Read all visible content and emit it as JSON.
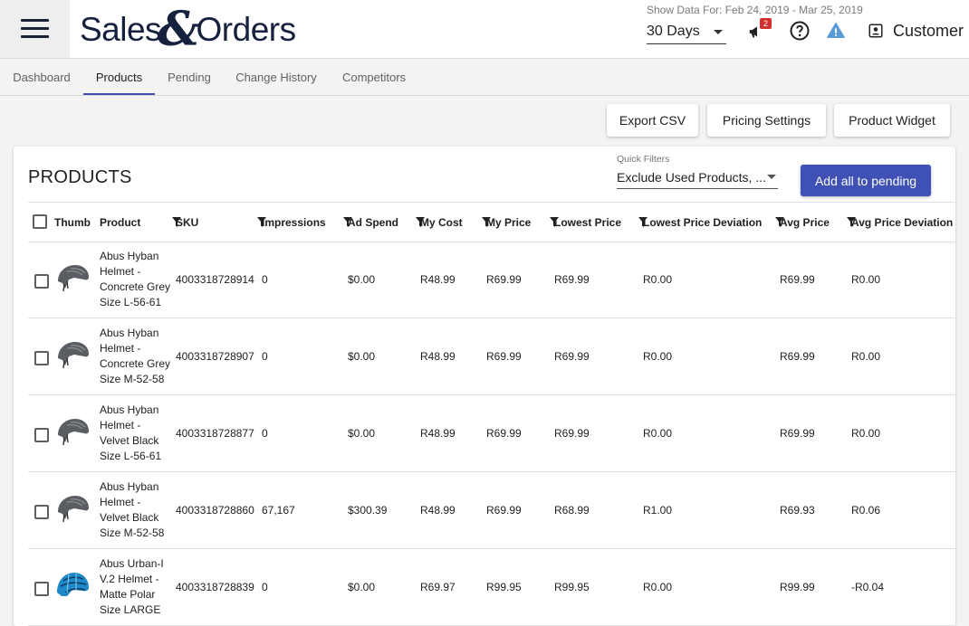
{
  "header": {
    "logo_left": "Sales",
    "logo_amp": "&",
    "logo_right": "Orders",
    "show_data_label": "Show Data For: Feb 24, 2019 - Mar 25, 2019",
    "days_value": "30 Days",
    "notification_count": "2",
    "customer_label": "Customer",
    "icons": [
      "menu-icon",
      "megaphone-icon",
      "help-icon",
      "alert-triangle-icon",
      "account-box-icon"
    ]
  },
  "tabs": [
    {
      "label": "Dashboard",
      "active": false
    },
    {
      "label": "Products",
      "active": true
    },
    {
      "label": "Pending",
      "active": false
    },
    {
      "label": "Change History",
      "active": false
    },
    {
      "label": "Competitors",
      "active": false
    }
  ],
  "actions": {
    "export_csv": "Export CSV",
    "pricing_settings": "Pricing Settings",
    "product_widget": "Product Widget"
  },
  "card": {
    "title": "PRODUCTS",
    "quick_filters_label": "Quick Filters",
    "quick_filters_value": "Exclude Used Products, ...",
    "add_all_label": "Add all to pending"
  },
  "table": {
    "columns": [
      "Thumb",
      "Product",
      "SKU",
      "Impressions",
      "Ad Spend",
      "My Cost",
      "My Price",
      "Lowest Price",
      "Lowest Price Deviation",
      "Avg Price",
      "Avg Price Deviation"
    ],
    "rows": [
      {
        "product": "Abus Hyban Helmet - Concrete Grey Size L-56-61",
        "thumb": "grey",
        "sku": "4003318728914",
        "impressions": "0",
        "ad_spend": "$0.00",
        "my_cost": "R48.99",
        "my_price": "R69.99",
        "lowest_price": "R69.99",
        "lowest_dev": "R0.00",
        "avg_price": "R69.99",
        "avg_dev": "R0.00"
      },
      {
        "product": "Abus Hyban Helmet - Concrete Grey Size M-52-58",
        "thumb": "grey",
        "sku": "4003318728907",
        "impressions": "0",
        "ad_spend": "$0.00",
        "my_cost": "R48.99",
        "my_price": "R69.99",
        "lowest_price": "R69.99",
        "lowest_dev": "R0.00",
        "avg_price": "R69.99",
        "avg_dev": "R0.00"
      },
      {
        "product": "Abus Hyban Helmet - Velvet Black Size L-56-61",
        "thumb": "grey",
        "sku": "4003318728877",
        "impressions": "0",
        "ad_spend": "$0.00",
        "my_cost": "R48.99",
        "my_price": "R69.99",
        "lowest_price": "R69.99",
        "lowest_dev": "R0.00",
        "avg_price": "R69.99",
        "avg_dev": "R0.00"
      },
      {
        "product": "Abus Hyban Helmet - Velvet Black Size M-52-58",
        "thumb": "grey",
        "sku": "4003318728860",
        "impressions": "67,167",
        "ad_spend": "$300.39",
        "my_cost": "R48.99",
        "my_price": "R69.99",
        "lowest_price": "R68.99",
        "lowest_dev": "R1.00",
        "avg_price": "R69.93",
        "avg_dev": "R0.06"
      },
      {
        "product": "Abus Urban-I V.2 Helmet - Matte Polar Size LARGE",
        "thumb": "blue",
        "sku": "4003318728839",
        "impressions": "0",
        "ad_spend": "$0.00",
        "my_cost": "R69.97",
        "my_price": "R99.95",
        "lowest_price": "R99.95",
        "lowest_dev": "R0.00",
        "avg_price": "R99.99",
        "avg_dev": "-R0.04"
      }
    ]
  },
  "colors": {
    "primary": "#3f51b5",
    "badge": "#d32f2f",
    "alert_icon": "#5b9bd5",
    "helmet_grey": "#5a5e63",
    "helmet_blue": "#1e88c8"
  }
}
